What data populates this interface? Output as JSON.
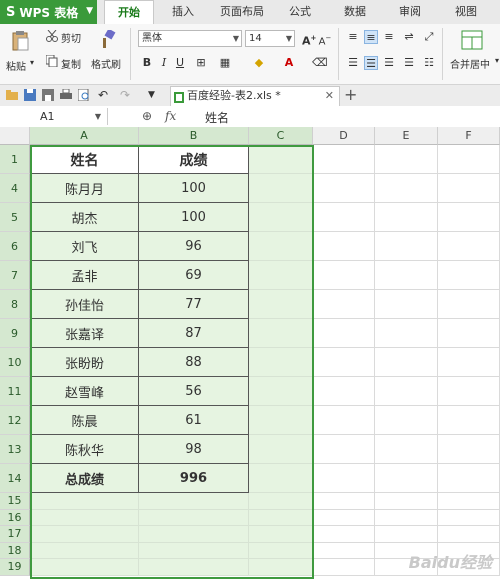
{
  "app": {
    "menu_label": "WPS 表格",
    "accent": "#3a9a3a"
  },
  "tabs": [
    "开始",
    "插入",
    "页面布局",
    "公式",
    "数据",
    "审阅",
    "视图"
  ],
  "active_tab": "开始",
  "ribbon": {
    "paste": "粘贴",
    "cut": "剪切",
    "copy": "复制",
    "format_painter": "格式刷",
    "font_name": "黑体",
    "font_size": "14",
    "merge_center": "合并居中"
  },
  "document_tab": "百度经验-表2.xls *",
  "formula_bar": {
    "name_box": "A1",
    "fx": "fx",
    "content": "姓名"
  },
  "columns": [
    "A",
    "B",
    "C",
    "D",
    "E",
    "F"
  ],
  "table": {
    "header": {
      "row": "1",
      "name": "姓名",
      "score": "成绩"
    },
    "rows": [
      {
        "row": "4",
        "name": "陈月月",
        "score": "100"
      },
      {
        "row": "5",
        "name": "胡杰",
        "score": "100"
      },
      {
        "row": "6",
        "name": "刘飞",
        "score": "96"
      },
      {
        "row": "7",
        "name": "孟非",
        "score": "69"
      },
      {
        "row": "8",
        "name": "孙佳怡",
        "score": "77"
      },
      {
        "row": "9",
        "name": "张嘉译",
        "score": "87"
      },
      {
        "row": "10",
        "name": "张盼盼",
        "score": "88"
      },
      {
        "row": "11",
        "name": "赵雪峰",
        "score": "56"
      },
      {
        "row": "12",
        "name": "陈晨",
        "score": "61"
      },
      {
        "row": "13",
        "name": "陈秋华",
        "score": "98"
      }
    ],
    "total": {
      "row": "14",
      "name": "总成绩",
      "score": "996"
    }
  },
  "empty_rows": [
    "15",
    "16",
    "17",
    "18",
    "19"
  ],
  "watermark": "Baidu经验"
}
